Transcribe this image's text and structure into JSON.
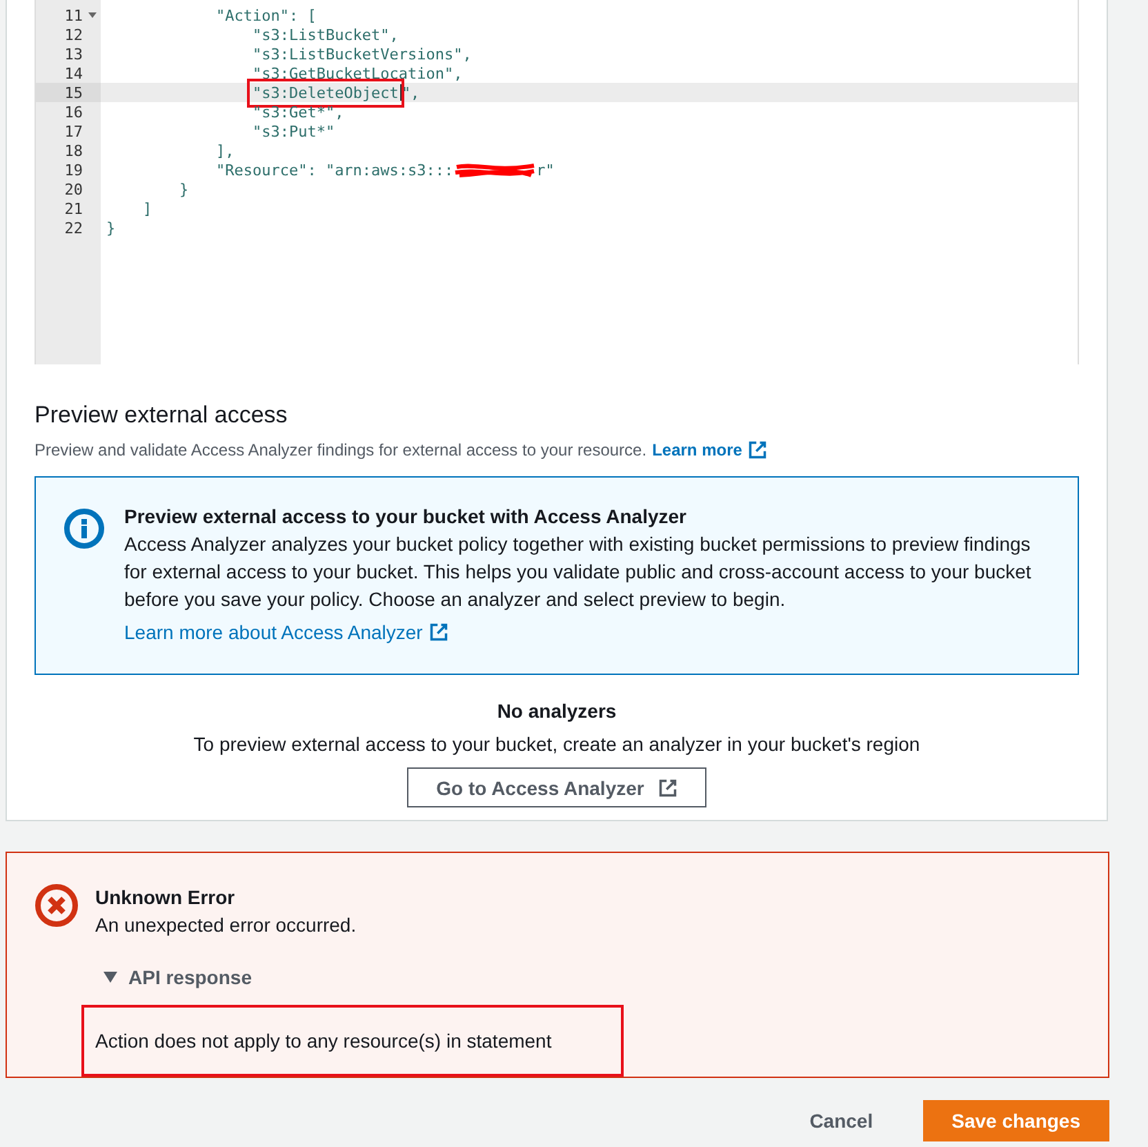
{
  "editor": {
    "lines": [
      {
        "number": "11",
        "foldable": true,
        "active": false,
        "segments": [
          {
            "kind": "text",
            "text": "            \"Action\": ["
          }
        ]
      },
      {
        "number": "12",
        "foldable": false,
        "active": false,
        "segments": [
          {
            "kind": "text",
            "text": "                \"s3:ListBucket\","
          }
        ]
      },
      {
        "number": "13",
        "foldable": false,
        "active": false,
        "segments": [
          {
            "kind": "text",
            "text": "                \"s3:ListBucketVersions\","
          }
        ]
      },
      {
        "number": "14",
        "foldable": false,
        "active": false,
        "segments": [
          {
            "kind": "text",
            "text": "                \"s3:GetBucketLocation\","
          }
        ]
      },
      {
        "number": "15",
        "foldable": false,
        "active": true,
        "segments": [
          {
            "kind": "marked",
            "text": "                \"s3:DeleteObject"
          },
          {
            "kind": "cursor"
          },
          {
            "kind": "text",
            "text": "\","
          }
        ]
      },
      {
        "number": "16",
        "foldable": false,
        "active": false,
        "segments": [
          {
            "kind": "text",
            "text": "                \"s3:Get*\","
          }
        ]
      },
      {
        "number": "17",
        "foldable": false,
        "active": false,
        "segments": [
          {
            "kind": "text",
            "text": "                \"s3:Put*\""
          }
        ]
      },
      {
        "number": "18",
        "foldable": false,
        "active": false,
        "segments": [
          {
            "kind": "text",
            "text": "            ],"
          }
        ]
      },
      {
        "number": "19",
        "foldable": false,
        "active": false,
        "segments": [
          {
            "kind": "text",
            "text": "            \"Resource\": \"arn:aws:s3:::"
          },
          {
            "kind": "redacted"
          },
          {
            "kind": "text",
            "text": "r\""
          }
        ]
      },
      {
        "number": "20",
        "foldable": false,
        "active": false,
        "segments": [
          {
            "kind": "text",
            "text": "        }"
          }
        ]
      },
      {
        "number": "21",
        "foldable": false,
        "active": false,
        "segments": [
          {
            "kind": "text",
            "text": "    ]"
          }
        ]
      },
      {
        "number": "22",
        "foldable": false,
        "active": false,
        "segments": [
          {
            "kind": "text",
            "text": "}"
          }
        ]
      }
    ]
  },
  "preview": {
    "title": "Preview external access",
    "description": "Preview and validate Access Analyzer findings for external access to your resource.",
    "learn_more": "Learn more",
    "info": {
      "title": "Preview external access to your bucket with Access Analyzer",
      "body": "Access Analyzer analyzes your bucket policy together with existing bucket permissions to preview findings for external access to your bucket. This helps you validate public and cross-account access to your bucket before you save your policy. Choose an analyzer and select preview to begin.",
      "link": "Learn more about Access Analyzer"
    },
    "empty_title": "No analyzers",
    "empty_text": "To preview external access to your bucket, create an analyzer in your bucket's region",
    "button": "Go to Access Analyzer"
  },
  "error": {
    "title": "Unknown Error",
    "message": "An unexpected error occurred.",
    "details": {
      "label": "API response",
      "expanded": true,
      "text": "Action does not apply to any resource(s) in statement"
    }
  },
  "footer": {
    "cancel": "Cancel",
    "save": "Save changes"
  }
}
